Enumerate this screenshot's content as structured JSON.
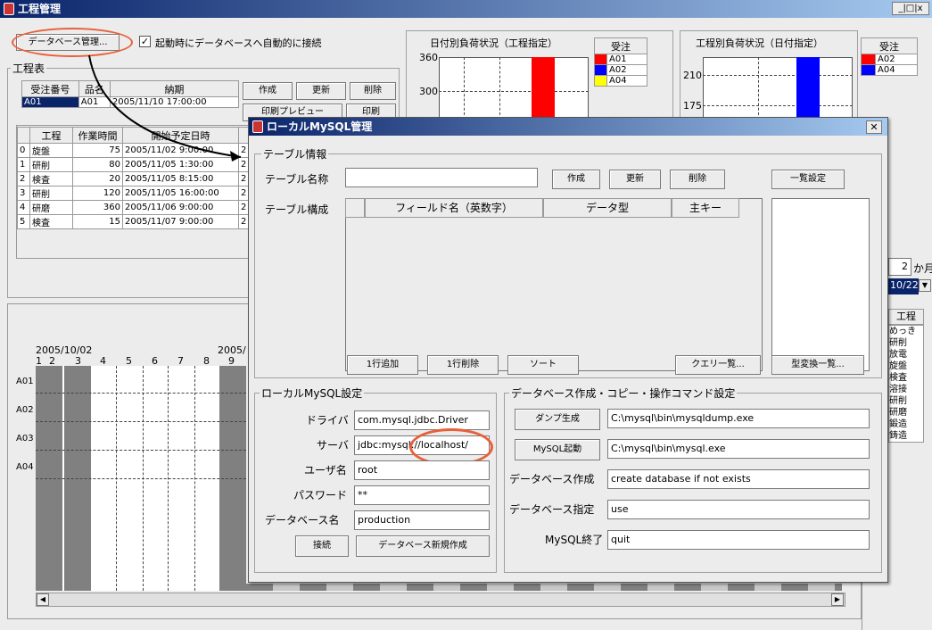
{
  "window": {
    "title": "工程管理",
    "controls": "_|□|x"
  },
  "top": {
    "db_button": "データベース管理...",
    "autoconnect_label": "起動時にデータベースへ自動的に接続",
    "autoconnect_checked": true
  },
  "order_table": {
    "group_title": "工程表",
    "headers": [
      "受注番号",
      "品名",
      "納期"
    ],
    "row": [
      "A01",
      "A01",
      "2005/11/10 17:00:00"
    ]
  },
  "order_buttons": {
    "create": "作成",
    "update": "更新",
    "delete": "削除",
    "print_preview": "印刷プレビュー",
    "print": "印刷"
  },
  "process_table": {
    "headers": [
      "",
      "工程",
      "作業時間",
      "開始予定日時"
    ],
    "rows": [
      [
        "0",
        "旋盤",
        "75",
        "2005/11/02 9:00:00",
        "2"
      ],
      [
        "1",
        "研削",
        "80",
        "2005/11/05 1:30:00",
        "2"
      ],
      [
        "2",
        "検査",
        "20",
        "2005/11/05 8:15:00",
        "2"
      ],
      [
        "3",
        "研削",
        "120",
        "2005/11/05 16:00:00",
        "2"
      ],
      [
        "4",
        "研磨",
        "360",
        "2005/11/06 9:00:00",
        "2"
      ],
      [
        "5",
        "検査",
        "15",
        "2005/11/07 9:00:00",
        "2"
      ]
    ]
  },
  "chart1": {
    "title": "日付別負荷状況（工程指定）",
    "legend_header": "受注",
    "legend": [
      {
        "label": "A01",
        "color": "#ff0000"
      },
      {
        "label": "A02",
        "color": "#0000ff"
      },
      {
        "label": "A04",
        "color": "#ffff00"
      }
    ],
    "ticks": [
      "360",
      "300"
    ]
  },
  "chart2": {
    "title": "工程別負荷状況（日付指定）",
    "legend_header": "受注",
    "legend": [
      {
        "label": "A02",
        "color": "#ff0000"
      },
      {
        "label": "A04",
        "color": "#0000ff"
      }
    ],
    "ticks": [
      "210",
      "175"
    ]
  },
  "right_panel": {
    "months_value": "2",
    "months_unit": "か月",
    "date_value": "10/22",
    "process_header": "工程",
    "process_items": [
      "めっき",
      "研削",
      "放電",
      "旋盤",
      "検査",
      "溶接",
      "研削",
      "研磨",
      "鍛造",
      "鋳造"
    ]
  },
  "gantt": {
    "date_left": "2005/10/02",
    "date_right": "2005/",
    "day_numbers": [
      "1",
      "2",
      "3",
      "4",
      "5",
      "6",
      "7",
      "8",
      "9"
    ],
    "rows": [
      "A01",
      "A02",
      "A03",
      "A04"
    ]
  },
  "dialog": {
    "title": "ローカルMySQL管理",
    "table_info": {
      "group_title": "テーブル情報",
      "name_label": "テーブル名称",
      "name_value": "",
      "create": "作成",
      "update": "更新",
      "delete": "削除",
      "list_settings": "一覧設定",
      "structure_label": "テーブル構成",
      "columns": [
        "",
        "フィールド名（英数字）",
        "データ型",
        "主キー"
      ],
      "add_row": "1行追加",
      "delete_row": "1行削除",
      "sort": "ソート",
      "query_list": "クエリ一覧...",
      "type_list": "型変換一覧..."
    },
    "mysql_settings": {
      "group_title": "ローカルMySQL設定",
      "driver_label": "ドライバ",
      "driver_value": "com.mysql.jdbc.Driver",
      "server_label": "サーバ",
      "server_value": "jdbc:mysql://localhost/",
      "user_label": "ユーザ名",
      "user_value": "root",
      "password_label": "パスワード",
      "password_value": "**",
      "dbname_label": "データベース名",
      "dbname_value": "production",
      "connect": "接続",
      "new_db": "データベース新規作成"
    },
    "commands": {
      "group_title": "データベース作成・コピー・操作コマンド設定",
      "dump_button": "ダンプ生成",
      "dump_value": "C:\\mysql\\bin\\mysqldump.exe",
      "start_button": "MySQL起動",
      "start_value": "C:\\mysql\\bin\\mysql.exe",
      "create_label": "データベース作成",
      "create_value": "create database if not exists",
      "select_label": "データベース指定",
      "select_value": "use",
      "quit_label": "MySQL終了",
      "quit_value": "quit"
    }
  }
}
